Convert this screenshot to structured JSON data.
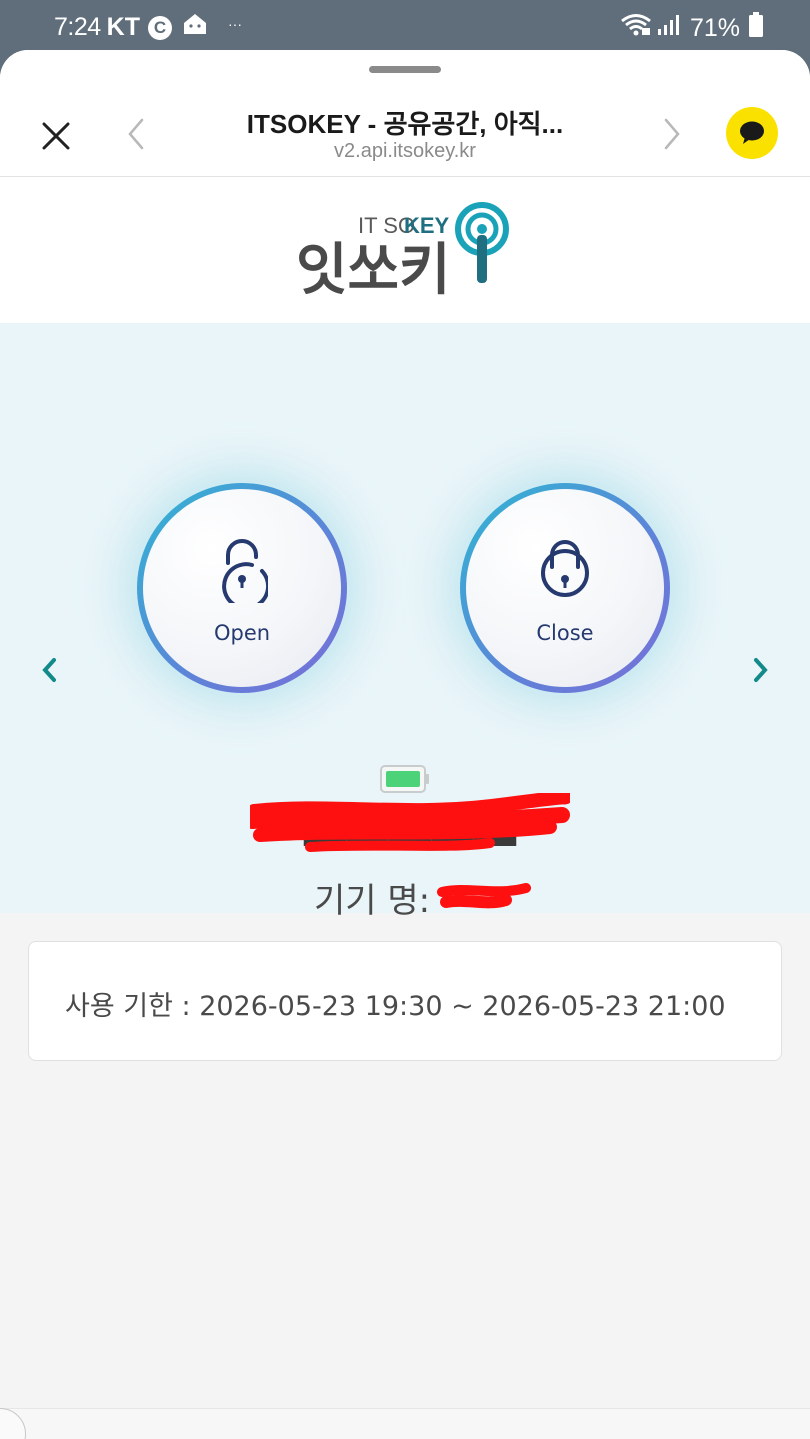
{
  "status_bar": {
    "time": "7:24",
    "carrier": "KT",
    "carrier_badge": "C",
    "more": "···",
    "battery_percent": "71%",
    "icons": [
      "c-badge-icon",
      "home-app-icon",
      "wifi-icon",
      "signal-icon",
      "battery-icon"
    ]
  },
  "browser": {
    "title": "ITSOKEY - 공유공간, 아직...",
    "url": "v2.api.itsokey.kr",
    "icons": [
      "close-icon",
      "chevron-left-icon",
      "chevron-right-icon",
      "kakaotalk-icon"
    ]
  },
  "logo": {
    "small_text_left": "IT SO",
    "small_text_right": "KEY",
    "main_text": "잇쏘키"
  },
  "controls": {
    "open_label": "Open",
    "close_label": "Close",
    "device_label": "기기 명:",
    "name_text": "██████████"
  },
  "usage": {
    "period_text": "사용 기한 : 2026-05-23 19:30 ~ 2026-05-23 21:00"
  },
  "colors": {
    "accent_teal": "#138a8a",
    "lock_navy": "#263a70",
    "kakao_yellow": "#fae100",
    "battery_green": "#4cd37a",
    "redaction_red": "#ff0000"
  }
}
